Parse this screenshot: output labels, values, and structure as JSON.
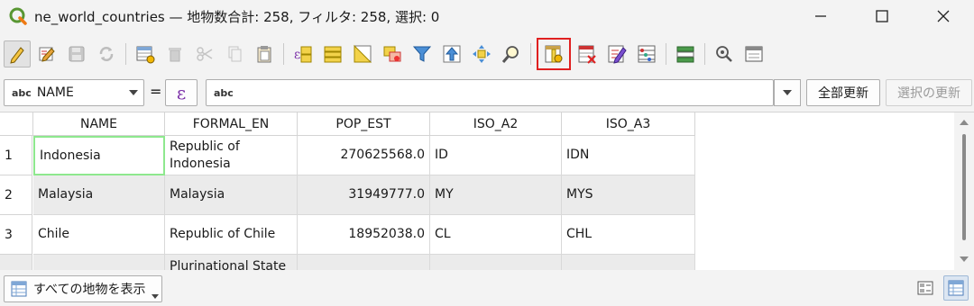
{
  "window": {
    "title": "ne_world_countries — 地物数合計: 258, フィルタ: 258, 選択: 0"
  },
  "toolbar": {
    "buttons": [
      {
        "name": "toggle-editing",
        "icon": "pencil-icon"
      },
      {
        "name": "multi-edit",
        "icon": "multi-edit-icon"
      },
      {
        "name": "save-edits",
        "icon": "save-icon"
      },
      {
        "name": "reload",
        "icon": "reload-icon"
      },
      {
        "name": "add-feature",
        "icon": "add-feature-icon"
      },
      {
        "name": "delete-selected",
        "icon": "trash-icon"
      },
      {
        "name": "cut",
        "icon": "scissors-icon"
      },
      {
        "name": "copy",
        "icon": "copy-icon"
      },
      {
        "name": "paste",
        "icon": "paste-icon"
      },
      {
        "name": "select-by-expression",
        "icon": "expression-select-icon"
      },
      {
        "name": "select-all",
        "icon": "select-all-icon"
      },
      {
        "name": "invert-selection",
        "icon": "invert-selection-icon"
      },
      {
        "name": "deselect-all",
        "icon": "deselect-icon"
      },
      {
        "name": "filter-select",
        "icon": "filter-icon"
      },
      {
        "name": "move-selected-top",
        "icon": "move-top-icon"
      },
      {
        "name": "pan-to-selected",
        "icon": "pan-icon"
      },
      {
        "name": "zoom-to-selected",
        "icon": "zoom-icon"
      },
      {
        "name": "new-field",
        "icon": "new-field-icon"
      },
      {
        "name": "delete-field",
        "icon": "delete-field-icon"
      },
      {
        "name": "field-calculator",
        "icon": "edit-table-icon"
      },
      {
        "name": "conditional-format",
        "icon": "abacus-icon"
      },
      {
        "name": "dock",
        "icon": "dock-icon"
      },
      {
        "name": "actions",
        "icon": "actions-icon"
      },
      {
        "name": "form-view",
        "icon": "form-icon"
      }
    ]
  },
  "expression": {
    "field_type": "abc",
    "field": "NAME",
    "equals": "=",
    "epsilon": "ε",
    "input_type": "abc",
    "update_all_label": "全部更新",
    "update_selected_label": "選択の更新"
  },
  "table": {
    "columns": [
      "NAME",
      "FORMAL_EN",
      "POP_EST",
      "ISO_A2",
      "ISO_A3"
    ],
    "rows": [
      {
        "index": "1",
        "NAME": "Indonesia",
        "FORMAL_EN": "Republic of Indonesia",
        "POP_EST": "270625568.0",
        "ISO_A2": "ID",
        "ISO_A3": "IDN"
      },
      {
        "index": "2",
        "NAME": "Malaysia",
        "FORMAL_EN": "Malaysia",
        "POP_EST": "31949777.0",
        "ISO_A2": "MY",
        "ISO_A3": "MYS"
      },
      {
        "index": "3",
        "NAME": "Chile",
        "FORMAL_EN": "Republic of Chile",
        "POP_EST": "18952038.0",
        "ISO_A2": "CL",
        "ISO_A3": "CHL"
      },
      {
        "index": "",
        "NAME": "",
        "FORMAL_EN": "Plurinational State",
        "POP_EST": "",
        "ISO_A2": "",
        "ISO_A3": ""
      }
    ]
  },
  "footer": {
    "show_all_label": "すべての地物を表示"
  },
  "colors": {
    "highlight_border": "#e02020",
    "selected_cell_border": "#8ee88e",
    "alt_row": "#ebebeb"
  }
}
